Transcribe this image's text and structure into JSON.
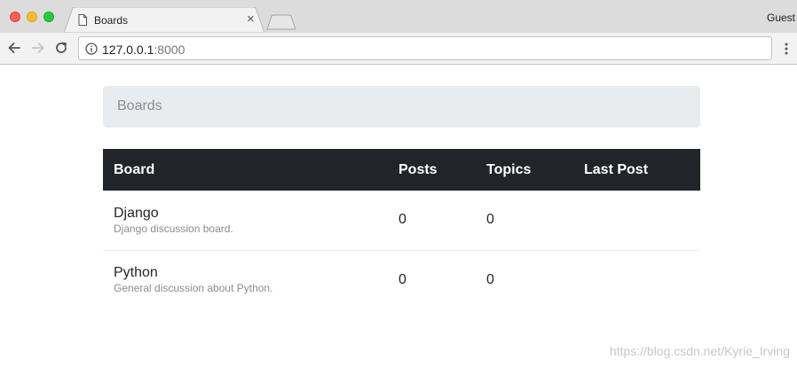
{
  "browser": {
    "tab_title": "Boards",
    "tab_close": "×",
    "profile_label": "Guest",
    "url_host": "127.0.0.1",
    "url_port": ":8000"
  },
  "page": {
    "breadcrumb": "Boards",
    "table": {
      "headers": [
        "Board",
        "Posts",
        "Topics",
        "Last Post"
      ],
      "rows": [
        {
          "name": "Django",
          "description": "Django discussion board.",
          "posts": "0",
          "topics": "0",
          "last_post": ""
        },
        {
          "name": "Python",
          "description": "General discussion about Python.",
          "posts": "0",
          "topics": "0",
          "last_post": ""
        }
      ]
    }
  },
  "watermark": "https://blog.csdn.net/Kyrie_Irving"
}
